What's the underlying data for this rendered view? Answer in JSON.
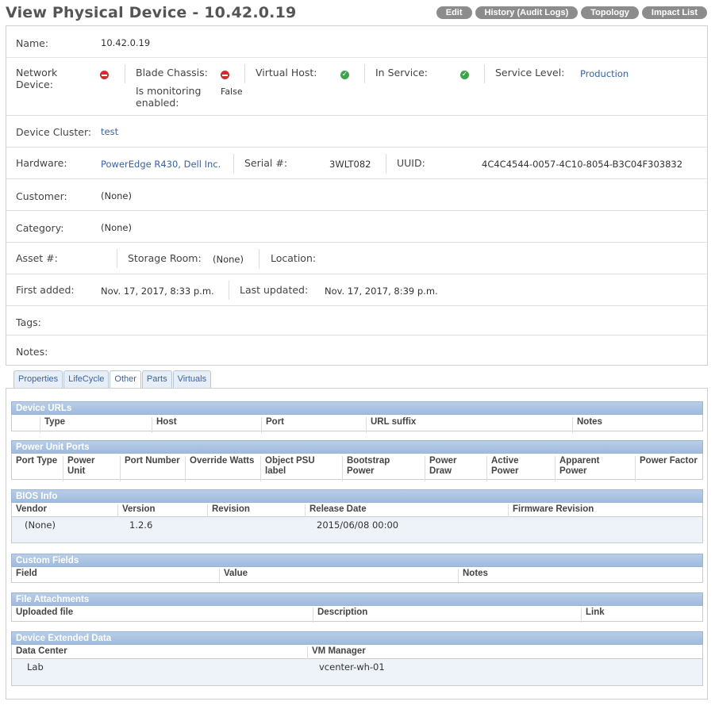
{
  "page": {
    "title": "View Physical Device - 10.42.0.19",
    "buttons": [
      "Edit",
      "History (Audit Logs)",
      "Topology",
      "Impact List"
    ]
  },
  "details": {
    "name_label": "Name:",
    "name_value": "10.42.0.19",
    "network_device_label": "Network Device:",
    "blade_chassis_label": "Blade Chassis:",
    "virtual_host_label": "Virtual Host:",
    "in_service_label": "In Service:",
    "service_level_label": "Service Level:",
    "service_level_value": "Production",
    "monitoring_label": "Is monitoring enabled:",
    "monitoring_value": "False",
    "device_cluster_label": "Device Cluster:",
    "device_cluster_value": "test",
    "hardware_label": "Hardware:",
    "hardware_value": "PowerEdge R430, Dell Inc.",
    "serial_label": "Serial #:",
    "serial_value": "3WLT082",
    "uuid_label": "UUID:",
    "uuid_value": "4C4C4544-0057-4C10-8054-B3C04F303832",
    "customer_label": "Customer:",
    "customer_value": "(None)",
    "category_label": "Category:",
    "category_value": "(None)",
    "asset_label": "Asset #:",
    "storage_room_label": "Storage Room:",
    "storage_room_value": "(None)",
    "location_label": "Location:",
    "first_added_label": "First added:",
    "first_added_value": "Nov. 17, 2017, 8:33 p.m.",
    "last_updated_label": "Last updated:",
    "last_updated_value": "Nov. 17, 2017, 8:39 p.m.",
    "tags_label": "Tags:",
    "notes_label": "Notes:"
  },
  "tabs": [
    "Properties",
    "LifeCycle",
    "Other",
    "Parts",
    "Virtuals"
  ],
  "sections": {
    "device_urls": {
      "title": "Device URLs",
      "columns": [
        "Type",
        "Host",
        "Port",
        "URL suffix",
        "Notes"
      ]
    },
    "power_unit_ports": {
      "title": "Power Unit Ports",
      "columns": [
        "Port Type",
        "Power Unit",
        "Port Number",
        "Override Watts",
        "Object PSU label",
        "Bootstrap Power",
        "Power Draw",
        "Active Power",
        "Apparent Power",
        "Power Factor"
      ]
    },
    "bios_info": {
      "title": "BIOS Info",
      "columns": [
        "Vendor",
        "Version",
        "Revision",
        "Release Date",
        "Firmware Revision"
      ],
      "row": [
        "(None)",
        "1.2.6",
        "",
        "2015/06/08 00:00",
        ""
      ]
    },
    "custom_fields": {
      "title": "Custom Fields",
      "columns": [
        "Field",
        "Value",
        "Notes"
      ]
    },
    "file_attachments": {
      "title": "File Attachments",
      "columns": [
        "Uploaded file",
        "Description",
        "Link"
      ]
    },
    "extended_data": {
      "title": "Device Extended Data",
      "columns": [
        "Data Center",
        "VM Manager"
      ],
      "row": [
        "Lab",
        "vcenter-wh-01"
      ]
    }
  },
  "colors": {
    "accent_link": "#3b62a0",
    "section_header": "#a9c3e2",
    "button_gray": "#8c8c8c",
    "status_red": "#cc2f2f",
    "status_green": "#3ca54a"
  },
  "icons": {
    "network_device": "no-entry-icon",
    "blade_chassis": "no-entry-icon",
    "virtual_host": "check-icon",
    "in_service": "check-icon"
  }
}
